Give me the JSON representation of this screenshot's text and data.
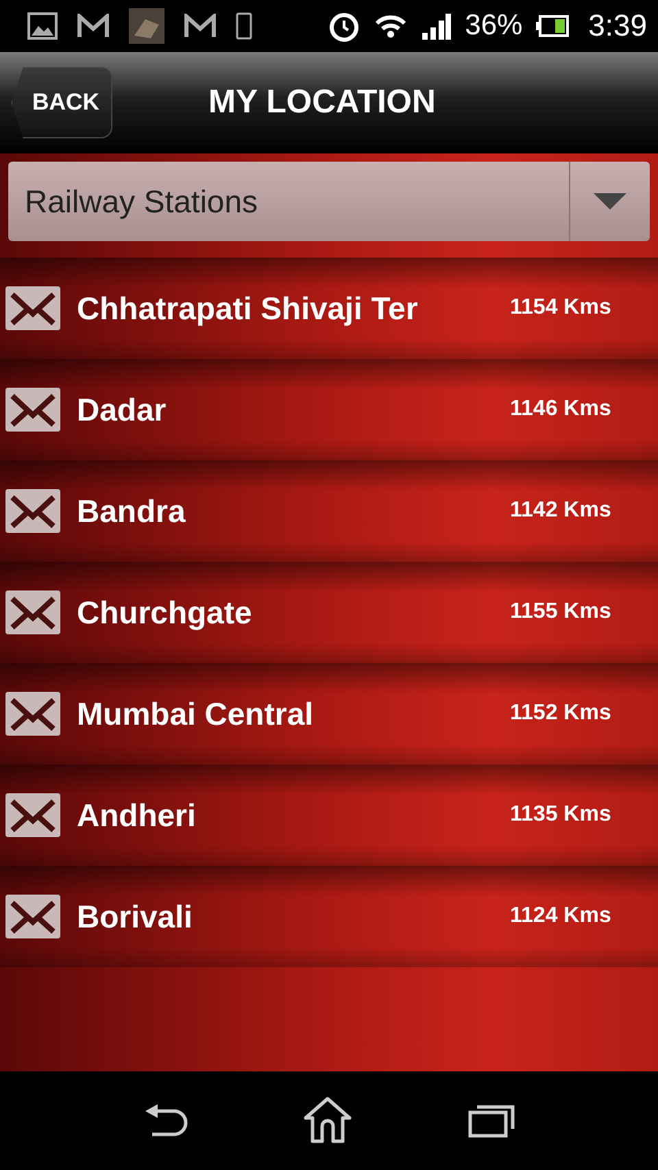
{
  "status_bar": {
    "battery": "36%",
    "time": "3:39"
  },
  "header": {
    "back": "BACK",
    "title": "MY LOCATION"
  },
  "dropdown": {
    "value": "Railway Stations"
  },
  "stations": [
    {
      "name": "Chhatrapati Shivaji Ter",
      "distance": "1154 Kms"
    },
    {
      "name": "Dadar",
      "distance": "1146 Kms"
    },
    {
      "name": "Bandra",
      "distance": "1142 Kms"
    },
    {
      "name": "Churchgate",
      "distance": "1155 Kms"
    },
    {
      "name": "Mumbai Central",
      "distance": "1152 Kms"
    },
    {
      "name": "Andheri",
      "distance": "1135 Kms"
    },
    {
      "name": "Borivali",
      "distance": "1124 Kms"
    }
  ]
}
